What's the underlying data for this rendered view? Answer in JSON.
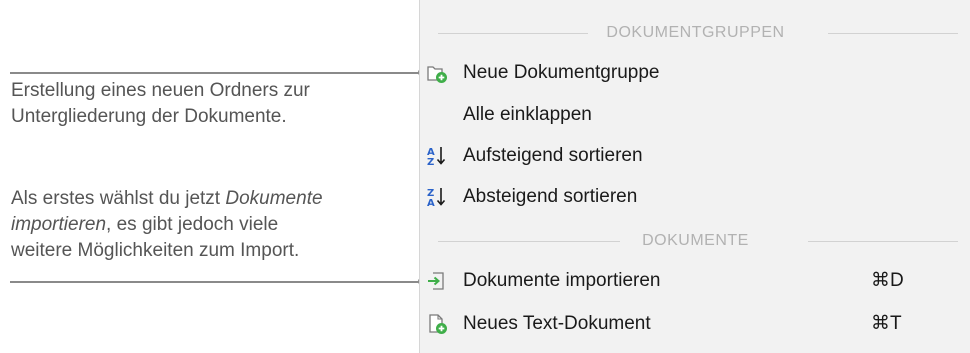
{
  "annotations": {
    "note1": {
      "line1": "Erstellung eines neuen Ordners zur",
      "line2": "Untergliederung der Dokumente."
    },
    "note2": {
      "line1_plain": "Als erstes wählst du jetzt ",
      "line1_em": "Dokumente",
      "line2_em": "importieren",
      "line2_plain": ", es gibt jedoch viele",
      "line3": "weitere Möglichkeiten zum Import."
    }
  },
  "menu": {
    "sections": [
      {
        "title": "DOKUMENTGRUPPEN",
        "items": [
          {
            "label": "Neue Dokumentgruppe",
            "icon": "new-folder-icon",
            "shortcut": ""
          },
          {
            "label": "Alle einklappen",
            "icon": "",
            "shortcut": ""
          },
          {
            "label": "Aufsteigend sortieren",
            "icon": "sort-ascending-icon",
            "shortcut": ""
          },
          {
            "label": "Absteigend sortieren",
            "icon": "sort-descending-icon",
            "shortcut": ""
          }
        ]
      },
      {
        "title": "DOKUMENTE",
        "items": [
          {
            "label": "Dokumente importieren",
            "icon": "import-icon",
            "shortcut": "⌘D"
          },
          {
            "label": "Neues Text-Dokument",
            "icon": "new-document-icon",
            "shortcut": "⌘T"
          }
        ]
      }
    ]
  },
  "colors": {
    "accent_green": "#3fae49",
    "sort_blue": "#2a62c9",
    "menu_bg": "#f2f2f2",
    "leader_gray": "#8a8a8a"
  }
}
